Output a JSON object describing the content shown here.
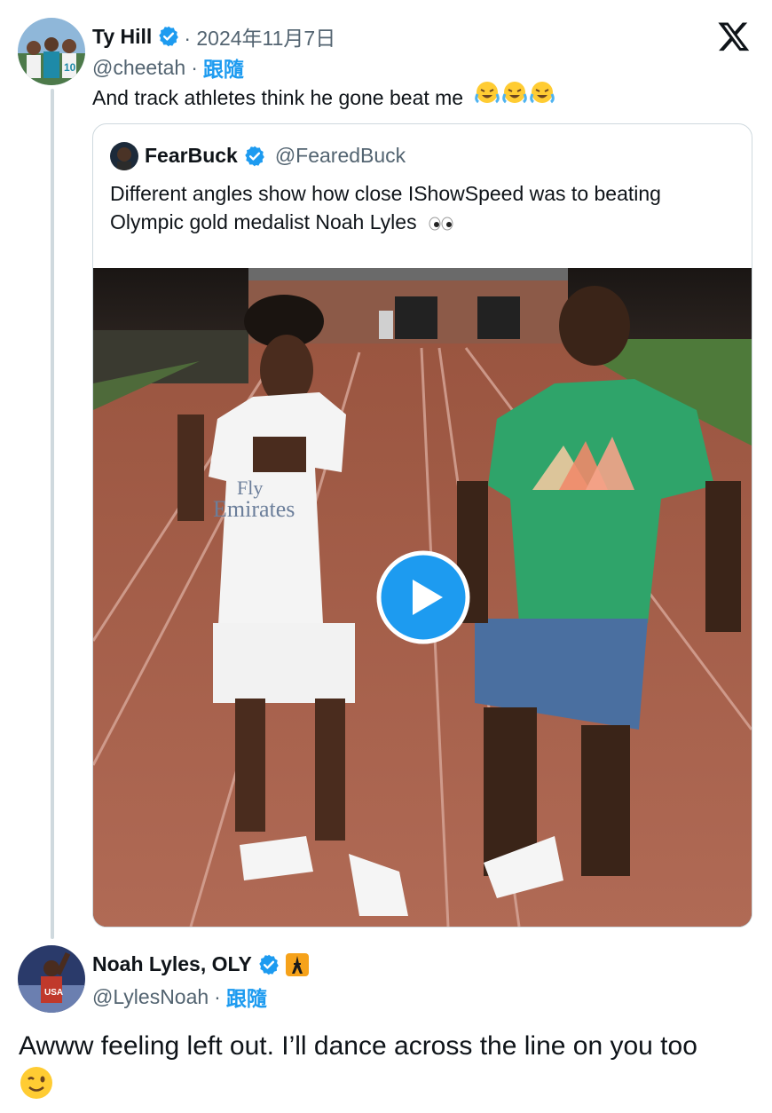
{
  "tweet1": {
    "name": "Ty Hill",
    "date": "· 2024年11月7日",
    "handle": "@cheetah",
    "separator": "·",
    "follow_label": "跟隨",
    "text": "And track athletes think he gone beat me",
    "emoji": "face-with-tears-of-joy x3"
  },
  "quote": {
    "name": "FearBuck",
    "handle": "@FearedBuck",
    "text_line1": "Different angles show how close IShowSpeed was to beating",
    "text_line2": "Olympic gold medalist Noah Lyles",
    "emoji": "eyes",
    "video": {
      "jersey_text_line1": "Fly",
      "jersey_text_line2": "Emirates"
    }
  },
  "tweet2": {
    "name": "Noah Lyles, OLY",
    "handle": "@LylesNoah",
    "separator": "·",
    "follow_label": "跟隨",
    "text": "Awww feeling left out. I’ll dance across the line on you too",
    "emoji": "winking-face"
  },
  "colors": {
    "accent": "#1d9bf0",
    "secondary_text": "#536471",
    "border": "#cfd9de",
    "play_button": "#1d9bf0"
  }
}
